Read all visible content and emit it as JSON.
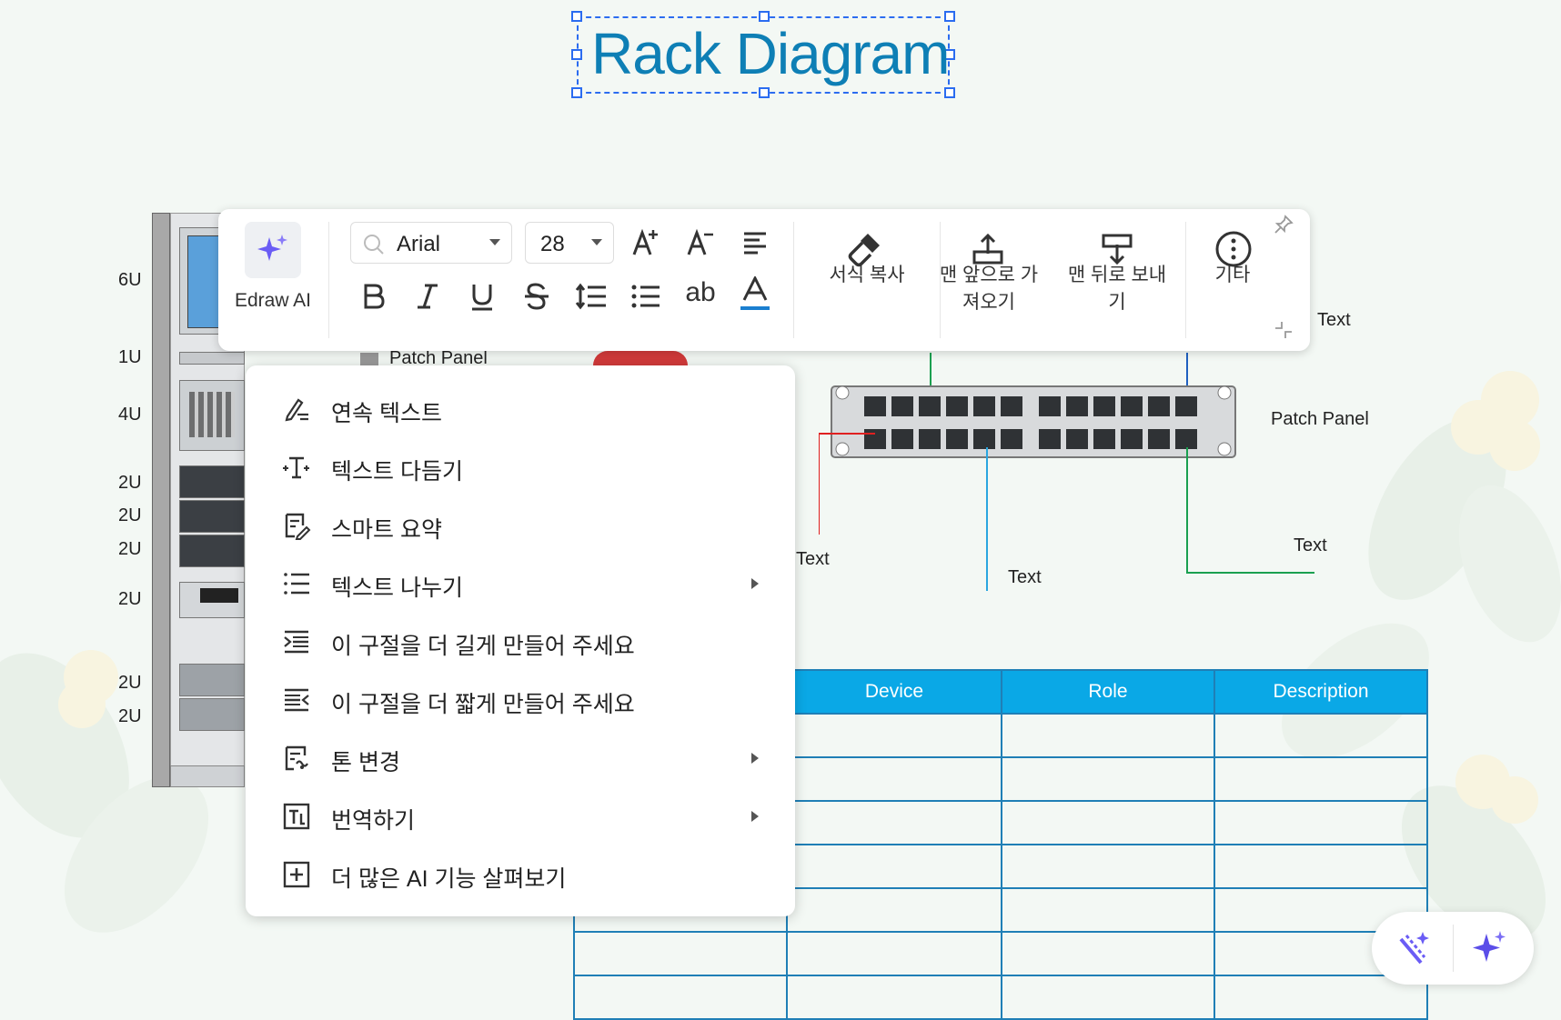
{
  "canvas": {
    "title": "Rack Diagram",
    "rack_units": [
      "6U",
      "1U",
      "4U",
      "2U",
      "2U",
      "2U",
      "2U",
      "2U",
      "2U"
    ],
    "labels": {
      "patch_panel_left": "Patch Panel",
      "patch_panel_right": "Patch Panel",
      "text_top_right": "Text",
      "text_red": "Text",
      "text_blue": "Text",
      "text_green": "Text"
    },
    "table": {
      "headers": [
        "Device",
        "Role",
        "Description"
      ]
    }
  },
  "toolbar": {
    "ai_label": "Edraw AI",
    "font_name": "Arial",
    "font_size": "28",
    "format_painter": "서식 복사",
    "bring_front_line1": "맨 앞으로 가",
    "bring_front_line2": "져오기",
    "send_back_line1": "맨 뒤로 보내",
    "send_back_line2": "기",
    "more": "기타",
    "ab_label": "ab"
  },
  "context_menu": {
    "items": [
      {
        "label": "연속 텍스트",
        "icon": "pen-text-icon",
        "submenu": false
      },
      {
        "label": "텍스트 다듬기",
        "icon": "text-refine-icon",
        "submenu": false
      },
      {
        "label": "스마트 요약",
        "icon": "summary-icon",
        "submenu": false
      },
      {
        "label": "텍스트 나누기",
        "icon": "list-split-icon",
        "submenu": true
      },
      {
        "label": "이 구절을 더 길게 만들어 주세요",
        "icon": "expand-text-icon",
        "submenu": false
      },
      {
        "label": "이 구절을 더 짧게 만들어 주세요",
        "icon": "shorten-text-icon",
        "submenu": false
      },
      {
        "label": "톤 변경",
        "icon": "tone-icon",
        "submenu": true
      },
      {
        "label": "번역하기",
        "icon": "translate-icon",
        "submenu": true
      },
      {
        "label": "더 많은 AI 기능 살펴보기",
        "icon": "plus-box-icon",
        "submenu": false
      }
    ]
  },
  "colors": {
    "title": "#0e7fb5",
    "selection": "#2b6cf0",
    "table_header": "#0aa8e6",
    "line_red": "#e02020",
    "line_blue": "#2aa6e0",
    "line_green": "#1aa050",
    "ai_accent": "#6a5cf5"
  }
}
